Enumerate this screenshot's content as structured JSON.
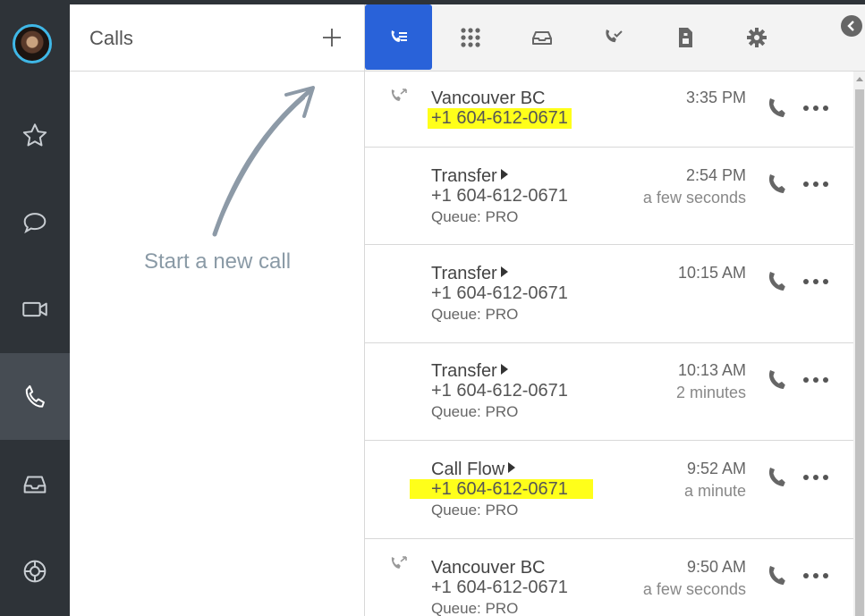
{
  "rail": {
    "items": [
      {
        "name": "favorites",
        "icon": "star-icon"
      },
      {
        "name": "chat",
        "icon": "chat-bubble-icon"
      },
      {
        "name": "video",
        "icon": "video-camera-icon"
      },
      {
        "name": "calls",
        "icon": "phone-icon",
        "active": true
      },
      {
        "name": "inbox",
        "icon": "inbox-tray-icon"
      },
      {
        "name": "support",
        "icon": "lifebuoy-icon"
      }
    ],
    "accent": "#3fb7e6"
  },
  "calls_panel": {
    "title": "Calls",
    "add_label": "+",
    "empty_message": "Start a new call"
  },
  "toolbar": {
    "tabs": [
      {
        "name": "call-history",
        "icon": "call-log-icon",
        "active": true
      },
      {
        "name": "dialpad",
        "icon": "dialpad-icon"
      },
      {
        "name": "voicemail",
        "icon": "inbox-icon"
      },
      {
        "name": "missed-calls",
        "icon": "phone-check-icon"
      },
      {
        "name": "fax",
        "icon": "fax-icon"
      },
      {
        "name": "settings",
        "icon": "gear-icon"
      }
    ],
    "active_color": "#2962d9"
  },
  "calls": [
    {
      "direction_icon": "outgoing-call-icon",
      "name": "Vancouver BC",
      "has_caret": false,
      "phone": "+1 604-612-0671",
      "phone_highlighted": true,
      "queue": "",
      "time": "3:35 PM",
      "ago": ""
    },
    {
      "direction_icon": "",
      "name": "Transfer",
      "has_caret": true,
      "phone": "+1 604-612-0671",
      "phone_highlighted": false,
      "queue": "Queue: PRO",
      "time": "2:54 PM",
      "ago": "a few seconds"
    },
    {
      "direction_icon": "",
      "name": "Transfer",
      "has_caret": true,
      "phone": "+1 604-612-0671",
      "phone_highlighted": false,
      "queue": "Queue: PRO",
      "time": "10:15 AM",
      "ago": ""
    },
    {
      "direction_icon": "",
      "name": "Transfer",
      "has_caret": true,
      "phone": "+1 604-612-0671",
      "phone_highlighted": false,
      "queue": "Queue: PRO",
      "time": "10:13 AM",
      "ago": "2 minutes"
    },
    {
      "direction_icon": "",
      "name": "Call Flow",
      "has_caret": true,
      "phone": "+1 604-612-0671",
      "phone_highlighted": true,
      "queue": "Queue: PRO",
      "time": "9:52 AM",
      "ago": "a minute"
    },
    {
      "direction_icon": "outgoing-call-icon",
      "name": "Vancouver BC",
      "has_caret": false,
      "phone": "+1 604-612-0671",
      "phone_highlighted": false,
      "queue": "Queue: PRO",
      "time": "9:50 AM",
      "ago": "a few seconds"
    }
  ],
  "highlight_color": "#ffff1a"
}
